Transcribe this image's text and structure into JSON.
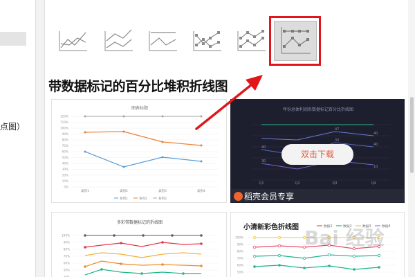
{
  "sidebar": {
    "truncated_label": "点图）"
  },
  "chart_types": [
    {
      "icon": "line-chart-icon"
    },
    {
      "icon": "stacked-line-chart-icon"
    },
    {
      "icon": "percent-stacked-line-chart-icon"
    },
    {
      "icon": "line-with-markers-chart-icon"
    },
    {
      "icon": "stacked-line-with-markers-chart-icon"
    },
    {
      "icon": "percent-stacked-line-with-markers-chart-icon",
      "selected": true
    }
  ],
  "section_title": "带数据标记的百分比堆积折线图",
  "templates": {
    "card_a": {
      "title": "图表标题",
      "y_ticks": [
        "120%",
        "110%",
        "100%",
        "90%",
        "80%",
        "70%",
        "60%",
        "50%",
        "40%",
        "30%",
        "20%",
        "10%",
        "0%"
      ],
      "categories": [
        "类别1",
        "类别2",
        "类别3",
        "类别4"
      ],
      "legend": [
        "系列1",
        "系列2",
        "系列3"
      ],
      "colors": [
        "#5b9bd5",
        "#ed7d31",
        "#a5a5a5"
      ]
    },
    "card_b": {
      "title": "年份总体利润系数据标记百分比折线图",
      "download_label": "双击下载",
      "member_label": "稻壳会员专享",
      "x_labels": [
        "Q1",
        "Q2",
        "Q3",
        "Q4"
      ],
      "point_labels": [
        "47",
        "40",
        "33",
        "40",
        "40",
        "30",
        "10",
        "18",
        "23",
        "35",
        "15"
      ],
      "accent": "#e25a3a"
    },
    "card_c": {
      "title": "多彩带数据标记的折线图",
      "y_ticks": [
        "100%",
        "90%",
        "80%",
        "70%",
        "60%",
        "50%",
        "40%"
      ]
    },
    "card_d": {
      "title": "小清新彩色折线图",
      "legend": [
        "数据1",
        "数据2",
        "数据3",
        "数据4"
      ],
      "legend_colors": [
        "#e8496a",
        "#1fb38a",
        "#e8c64a",
        "#9a7be0"
      ],
      "y_ticks": [
        "100%",
        "90%",
        "80%",
        "70%",
        "60%",
        "50%",
        "40%"
      ]
    }
  },
  "annotation": {
    "color": "#e0161b"
  },
  "watermark": "Bai 经验"
}
